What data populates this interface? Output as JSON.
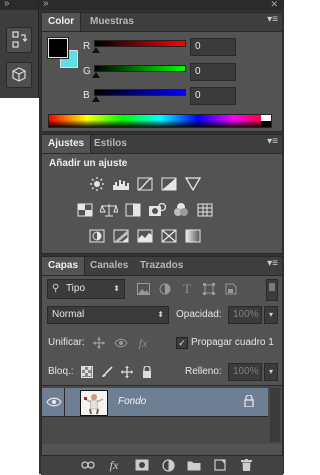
{
  "colors": {
    "panel_bg": "#535353",
    "dock_bg": "#323232",
    "selected_row": "#6e7f94",
    "foreground": "#000000",
    "background": "#5fe0e6"
  },
  "collapsed_dock": {
    "grip": "»",
    "buttons": [
      {
        "icon": "history-icon"
      },
      {
        "icon": "3d-cube-icon"
      }
    ]
  },
  "main_dock": {
    "grip": "»",
    "close": "✕"
  },
  "color_panel": {
    "tabs": [
      "Color",
      "Muestras"
    ],
    "menu_glyph": "▾≡",
    "sliders": [
      {
        "label": "R",
        "value": "0",
        "fraction": 0
      },
      {
        "label": "G",
        "value": "0",
        "fraction": 0
      },
      {
        "label": "B",
        "value": "0",
        "fraction": 0
      }
    ]
  },
  "adjustments_panel": {
    "tabs": [
      "Ajustes",
      "Estilos"
    ],
    "menu_glyph": "▾≡",
    "heading": "Añadir un ajuste",
    "icons": [
      [
        "brightness-contrast-icon",
        "levels-icon",
        "curves-icon",
        "exposure-icon",
        "vibrance-icon"
      ],
      [
        "hue-saturation-icon",
        "color-balance-icon",
        "black-white-icon",
        "photo-filter-icon",
        "channel-mixer-icon",
        "color-lookup-icon"
      ],
      [
        "invert-icon",
        "posterize-icon",
        "threshold-icon",
        "selective-color-icon",
        "gradient-map-icon"
      ]
    ]
  },
  "layers_panel": {
    "tabs": [
      "Capas",
      "Canales",
      "Trazados"
    ],
    "menu_glyph": "▾≡",
    "filter": {
      "search_glyph": "⚲",
      "value": "Tipo"
    },
    "blend_mode": "Normal",
    "opacity_label": "Opacidad:",
    "opacity_value": "100%",
    "unify_label": "Unificar:",
    "propagate_label": "Propagar cuadro 1",
    "lock_label": "Bloq.:",
    "fill_label": "Relleno:",
    "fill_value": "100%",
    "layers": [
      {
        "name": "Fondo",
        "visible": true,
        "locked": true
      }
    ],
    "bottom_icons": [
      "link-layers-icon",
      "fx-icon",
      "layer-mask-icon",
      "adjustment-layer-icon",
      "group-folder-icon",
      "new-layer-icon",
      "delete-layer-icon"
    ]
  }
}
